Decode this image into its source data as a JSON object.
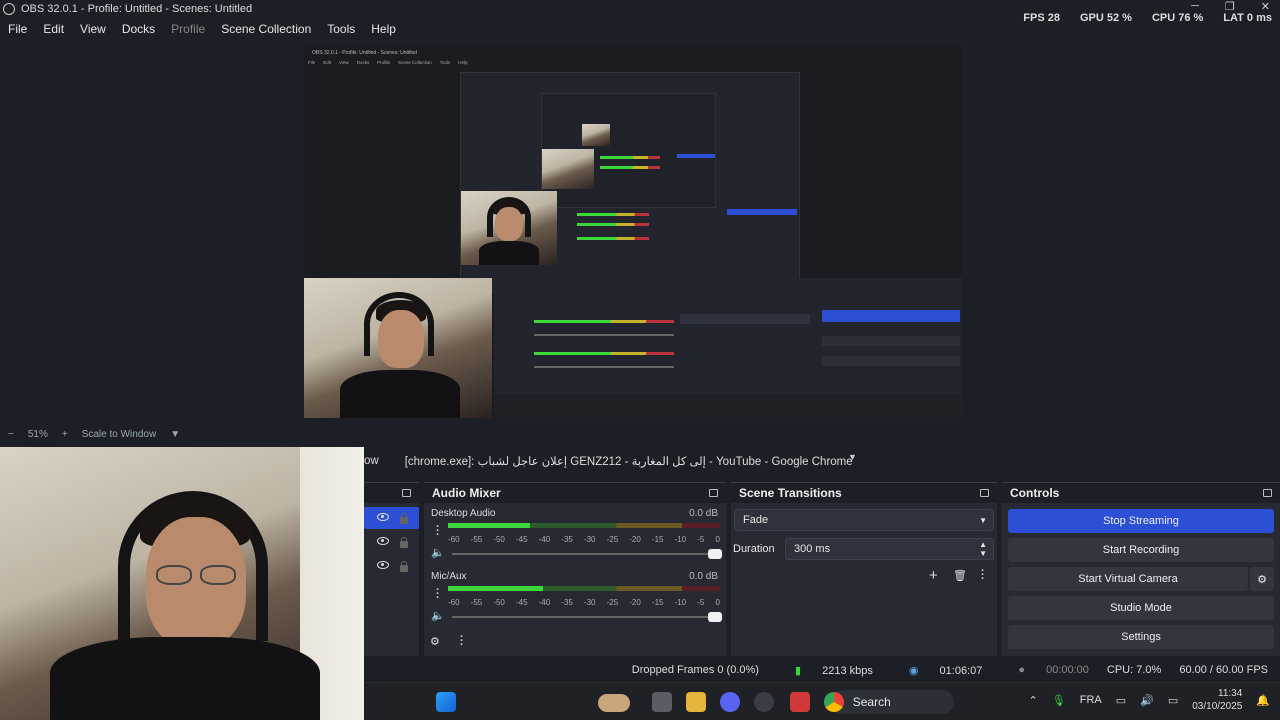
{
  "app": {
    "title": "OBS 32.0.1 - Profile: Untitled - Scenes: Untitled",
    "stats": {
      "fps": "FPS  28",
      "gpu": "GPU  52 %",
      "cpu": "CPU  76 %",
      "lat": "LAT  0 ms"
    }
  },
  "menu": [
    "File",
    "Edit",
    "View",
    "Docks",
    "Profile",
    "Scene Collection",
    "Tools",
    "Help"
  ],
  "preview": {
    "inner_title": "OBS 32.0.1 - Profile: Untitled - Scenes: Untitled",
    "inner_menu": [
      "File",
      "Edit",
      "View",
      "Docks",
      "Profile",
      "Scene Collection",
      "Tools",
      "Help"
    ],
    "zoom_label": "51%",
    "scale_label": "Scale to Window"
  },
  "source_bar": {
    "prefix": "ow",
    "selected": "[chrome.exe]: إعلان عاجل لشباب GENZ212 - إلى كل المغاربة - YouTube - Google Chrome"
  },
  "audio_mixer": {
    "title": "Audio Mixer",
    "ticks": [
      "-60",
      "-55",
      "-50",
      "-45",
      "-40",
      "-35",
      "-30",
      "-25",
      "-20",
      "-15",
      "-10",
      "-5",
      "0"
    ],
    "channels": [
      {
        "name": "Desktop Audio",
        "db": "0.0 dB",
        "level": 0.3
      },
      {
        "name": "Mic/Aux",
        "db": "0.0 dB",
        "level": 0.35
      }
    ]
  },
  "scene_transitions": {
    "title": "Scene Transitions",
    "transition": "Fade",
    "duration_label": "Duration",
    "duration_value": "300 ms"
  },
  "controls": {
    "title": "Controls",
    "buttons": [
      "Stop Streaming",
      "Start Recording",
      "Start Virtual Camera",
      "Studio Mode",
      "Settings"
    ]
  },
  "status": {
    "dropped": "Dropped Frames 0 (0.0%)",
    "bitrate": "2213 kbps",
    "stream_time": "01:06:07",
    "rec_time": "00:00:00",
    "cpu": "CPU: 7.0%",
    "fps": "60.00 / 60.00 FPS"
  },
  "taskbar": {
    "search": "Search",
    "lang": "FRA",
    "time": "11:34",
    "date": "03/10/2025"
  },
  "colors": {
    "accent": "#2d4fd6",
    "bg": "#1d1f26",
    "panel": "#272a33",
    "meter_green": "#3ad63a"
  }
}
